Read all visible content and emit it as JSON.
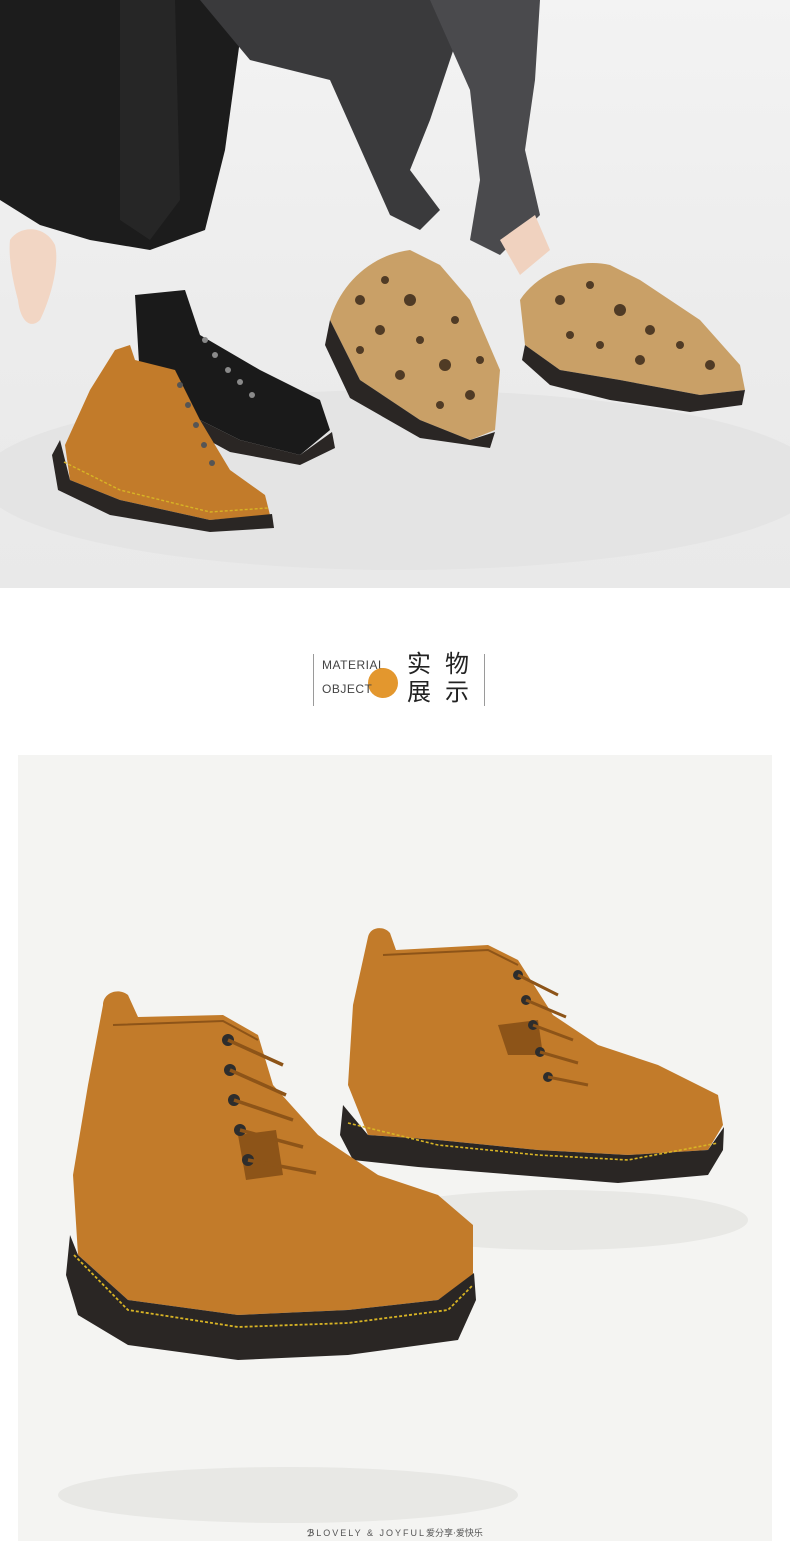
{
  "section_header": {
    "en_line1": "MATERIAL",
    "en_line2": "OBJECT",
    "cn_char1": "实",
    "cn_char2": "物",
    "cn_char3": "展",
    "cn_char4": "示",
    "accent_color": "#e3972e"
  },
  "footer": {
    "logo_glyph": "ℬ",
    "brand_en": "LOVELY & JOYFUL",
    "brand_cn": "爱分享·爱快乐"
  },
  "colors": {
    "boot_tan": "#c27b2a",
    "boot_black": "#1a1a1a",
    "leopard_base": "#c9a067",
    "sole": "#2a2624",
    "stitch": "#d8b424"
  }
}
